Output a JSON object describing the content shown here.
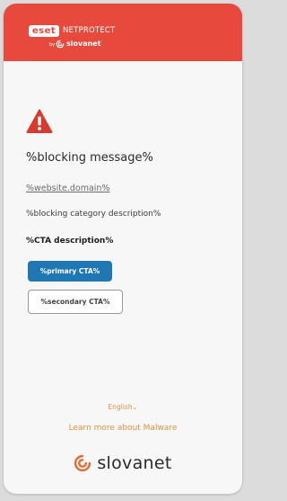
{
  "header": {
    "brand_badge": "eset",
    "product": "NETPROTECT",
    "by": "by",
    "partner": "slovanet",
    "background_color": "#e8493d"
  },
  "icons": {
    "warning": "warning-triangle-icon",
    "partner_logo": "slovanet-swirl-icon",
    "language_chevron": "chevron-down-icon"
  },
  "content": {
    "title": "%blocking message%",
    "domain": "%website.domain%",
    "category_description": "%blocking category description%",
    "cta_description": "%CTA description%"
  },
  "buttons": {
    "primary_label": "%primary CTA%",
    "secondary_label": "%secondary CTA%",
    "primary_color": "#1f77b4"
  },
  "footer": {
    "language": "English",
    "learn_more": "Learn more about Malware",
    "partner_logo": "slovanet",
    "link_color": "#e2903f"
  }
}
